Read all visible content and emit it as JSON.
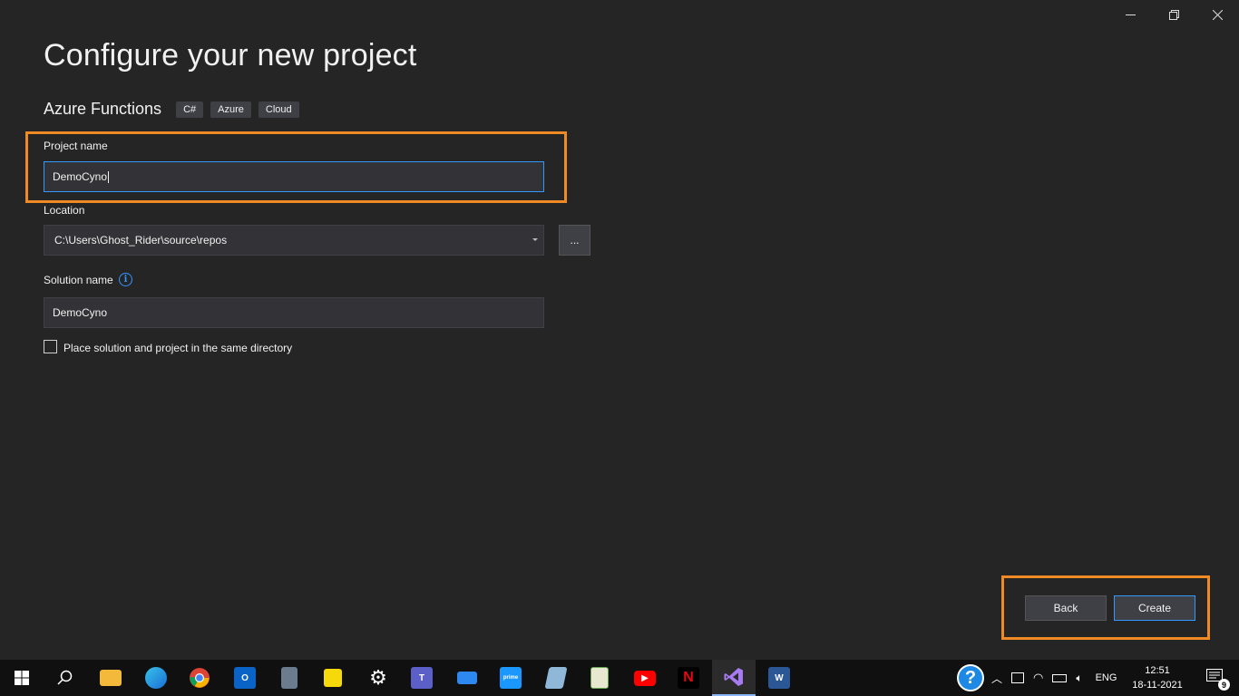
{
  "page": {
    "title": "Configure your new project",
    "template_name": "Azure Functions",
    "tags": [
      "C#",
      "Azure",
      "Cloud"
    ]
  },
  "form": {
    "project_name_label": "Project name",
    "project_name_value": "DemoCyno",
    "location_label": "Location",
    "location_value": "C:\\Users\\Ghost_Rider\\source\\repos",
    "browse_label": "...",
    "solution_name_label": "Solution name",
    "solution_name_value": "DemoCyno",
    "same_dir_label": "Place solution and project in the same directory",
    "same_dir_checked": false
  },
  "buttons": {
    "back": "Back",
    "create": "Create"
  },
  "taskbar": {
    "language": "ENG",
    "time": "12:51",
    "date": "18-11-2021",
    "notification_count": "9",
    "apps": [
      "windows-start",
      "search",
      "file-explorer",
      "edge",
      "chrome",
      "outlook",
      "calculator",
      "sticky-notes",
      "settings",
      "teams",
      "connect",
      "prime-video",
      "notepad-app",
      "app-installer",
      "youtube",
      "netflix",
      "visual-studio",
      "word"
    ]
  },
  "colors": {
    "background": "#252526",
    "highlight_border": "#f08a24",
    "focus_border": "#3399ff",
    "taskbar": "#101010"
  }
}
